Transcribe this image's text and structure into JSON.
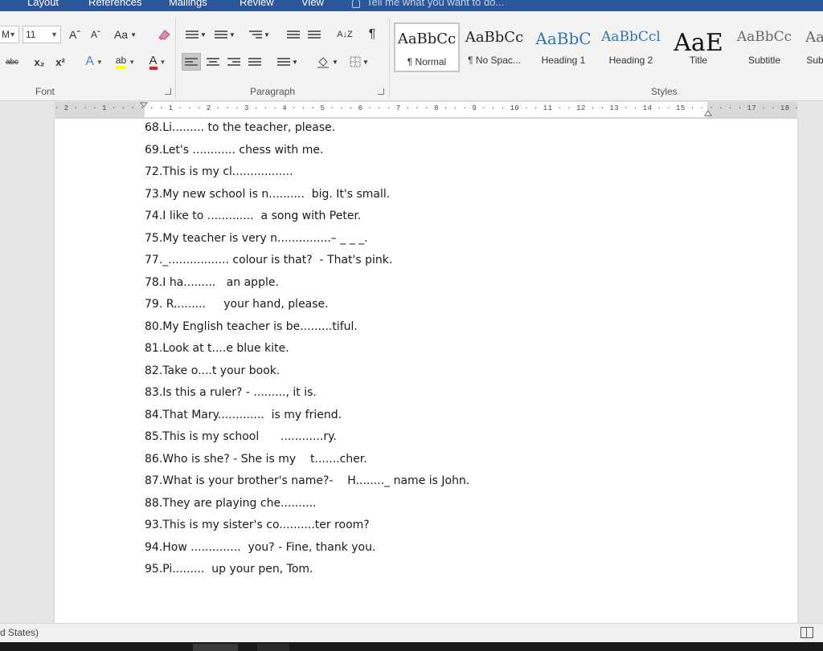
{
  "ribbon_tabs": [
    "Layout",
    "References",
    "Mailings",
    "Review",
    "View"
  ],
  "tell_me": "Tell me what you want to do...",
  "font_group": {
    "label": "Font",
    "font_name": "M",
    "font_size": "11",
    "grow_font": "Aˆ",
    "shrink_font": "Aˇ",
    "change_case": "Aa",
    "strikethrough": "abc",
    "subscript": "x₂",
    "superscript": "x²",
    "text_effects": "A",
    "highlight": "ab",
    "font_color": "A"
  },
  "paragraph_group": {
    "label": "Paragraph",
    "sort": "A↓Z",
    "pilcrow": "¶"
  },
  "styles_group": {
    "label": "Styles",
    "items": [
      {
        "sample": "AaBbCc",
        "name": "¶ Normal",
        "color": "#222222",
        "size": "18px",
        "selected": true
      },
      {
        "sample": "AaBbCc",
        "name": "¶ No Spac...",
        "color": "#222222",
        "size": "18px",
        "selected": false
      },
      {
        "sample": "AaBbC",
        "name": "Heading 1",
        "color": "#2e74b5",
        "size": "20px",
        "selected": false
      },
      {
        "sample": "AaBbCcl",
        "name": "Heading 2",
        "color": "#2e74b5",
        "size": "17px",
        "selected": false
      },
      {
        "sample": "AaE",
        "name": "Title",
        "color": "#111111",
        "size": "30px",
        "selected": false
      },
      {
        "sample": "AaBbCc",
        "name": "Subtitle",
        "color": "#666666",
        "size": "17px",
        "selected": false
      },
      {
        "sample": "Aa",
        "name": "Sub",
        "color": "#666666",
        "size": "18px",
        "selected": false
      }
    ]
  },
  "ruler_ticks": "· 2 · · · 1 · · · · · · 1 · · · 2 · · · 3 · · · 4 · · · 5 · · · 6 · · · 7 · · · 8 · · · 9 · · · 10 · · 11 · · 12 · · 13 · · 14 · · 15 · · · · · · 17 · · 18 ·",
  "document_lines": [
    "68.Li......... to the teacher, please.",
    "69.Let's ............ chess with me.",
    "72.This is my cl.................",
    "73.My new school is n..........  big. It's small.",
    "74.I like to .............  a song with Peter.",
    "75.My teacher is very n...............– _ _ _.",
    "77._................. colour is that?  - That's pink.",
    "78.I ha.........   an apple.",
    "79. R.........     your hand, please.",
    "80.My English teacher is be.........tiful.",
    "81.Look at t....e blue kite.",
    "82.Take o....t your book.",
    "83.Is this a ruler? - ........., it is.",
    "84.That Mary.............  is my friend.",
    "85.This is my school      ............ry.",
    "86.Who is she? - She is my    t.......cher.",
    "87.What is your brother's name?-    H........_ name is John.",
    "88.They are playing che..........",
    "93.This is my sister's co..........ter room?",
    "94.How ..............  you? - Fine, thank you.",
    "95.Pi.........  up your pen, Tom."
  ],
  "status_bar": {
    "language": "d States)"
  }
}
